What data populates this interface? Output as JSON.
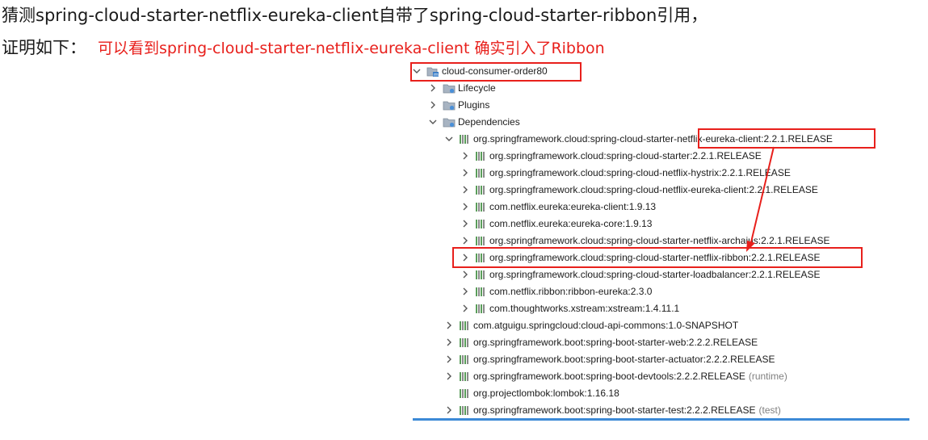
{
  "heading": "猜测spring-cloud-starter-netflix-eureka-client自带了spring-cloud-starter-ribbon引用，",
  "proof_label": "证明如下：",
  "proof_note": "可以看到spring-cloud-starter-netflix-eureka-client 确实引入了Ribbon",
  "colors": {
    "annotation_red": "#e8201c",
    "jar_green": "#5b9e5b",
    "rule_blue": "#3c8ad6"
  },
  "tree": {
    "project": {
      "label": "cloud-consumer-order80",
      "expanded": true,
      "icon": "maven-project-icon"
    },
    "groups": [
      {
        "label": "Lifecycle",
        "expanded": false,
        "icon": "lifecycle-folder-icon"
      },
      {
        "label": "Plugins",
        "expanded": false,
        "icon": "plugins-folder-icon"
      },
      {
        "label": "Dependencies",
        "expanded": true,
        "icon": "dependencies-folder-icon"
      }
    ],
    "dependencies": [
      {
        "label": "org.springframework.cloud:spring-cloud-starter-netflix-eureka-client:2.2.1.RELEASE",
        "expanded": true,
        "children": [
          {
            "label": "org.springframework.cloud:spring-cloud-starter:2.2.1.RELEASE"
          },
          {
            "label": "org.springframework.cloud:spring-cloud-netflix-hystrix:2.2.1.RELEASE"
          },
          {
            "label": "org.springframework.cloud:spring-cloud-netflix-eureka-client:2.2.1.RELEASE"
          },
          {
            "label": "com.netflix.eureka:eureka-client:1.9.13"
          },
          {
            "label": "com.netflix.eureka:eureka-core:1.9.13"
          },
          {
            "label": "org.springframework.cloud:spring-cloud-starter-netflix-archaius:2.2.1.RELEASE"
          },
          {
            "label": "org.springframework.cloud:spring-cloud-starter-netflix-ribbon:2.2.1.RELEASE"
          },
          {
            "label": "org.springframework.cloud:spring-cloud-starter-loadbalancer:2.2.1.RELEASE"
          },
          {
            "label": "com.netflix.ribbon:ribbon-eureka:2.3.0"
          },
          {
            "label": "com.thoughtworks.xstream:xstream:1.4.11.1"
          }
        ]
      },
      {
        "label": "com.atguigu.springcloud:cloud-api-commons:1.0-SNAPSHOT",
        "expanded": false
      },
      {
        "label": "org.springframework.boot:spring-boot-starter-web:2.2.2.RELEASE",
        "expanded": false
      },
      {
        "label": "org.springframework.boot:spring-boot-starter-actuator:2.2.2.RELEASE",
        "expanded": false
      },
      {
        "label": "org.springframework.boot:spring-boot-devtools:2.2.2.RELEASE",
        "scope": "(runtime)",
        "expanded": false
      },
      {
        "label": "org.projectlombok:lombok:1.16.18",
        "leaf": true
      },
      {
        "label": "org.springframework.boot:spring-boot-starter-test:2.2.2.RELEASE",
        "scope": "(test)",
        "expanded": false
      }
    ]
  }
}
